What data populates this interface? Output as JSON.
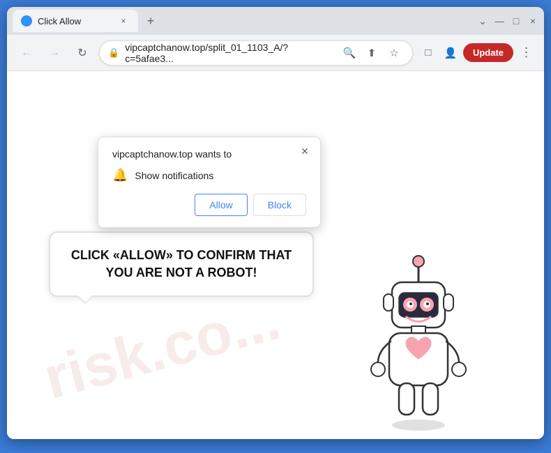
{
  "window": {
    "title": "Click Allow",
    "close_label": "×",
    "minimize_label": "—",
    "maximize_label": "□"
  },
  "tab": {
    "favicon_letter": "🌐",
    "title": "Click Allow",
    "close_symbol": "×"
  },
  "new_tab_symbol": "+",
  "toolbar": {
    "back_symbol": "←",
    "forward_symbol": "→",
    "refresh_symbol": "↻",
    "lock_symbol": "🔒",
    "url": "vipcaptchanow.top/split_01_1103_A/?c=5afae3...",
    "search_symbol": "🔍",
    "share_symbol": "⬆",
    "bookmark_symbol": "☆",
    "extension_symbol": "□",
    "profile_symbol": "👤",
    "update_label": "Update",
    "menu_symbol": "⋮"
  },
  "notification_popup": {
    "title": "vipcaptchanow.top wants to",
    "close_symbol": "×",
    "bell_symbol": "🔔",
    "permission_text": "Show notifications",
    "allow_label": "Allow",
    "block_label": "Block"
  },
  "speech_bubble": {
    "text": "CLICK «ALLOW» TO CONFIRM THAT YOU ARE NOT A ROBOT!"
  },
  "watermark": {
    "text": "risk.co..."
  }
}
